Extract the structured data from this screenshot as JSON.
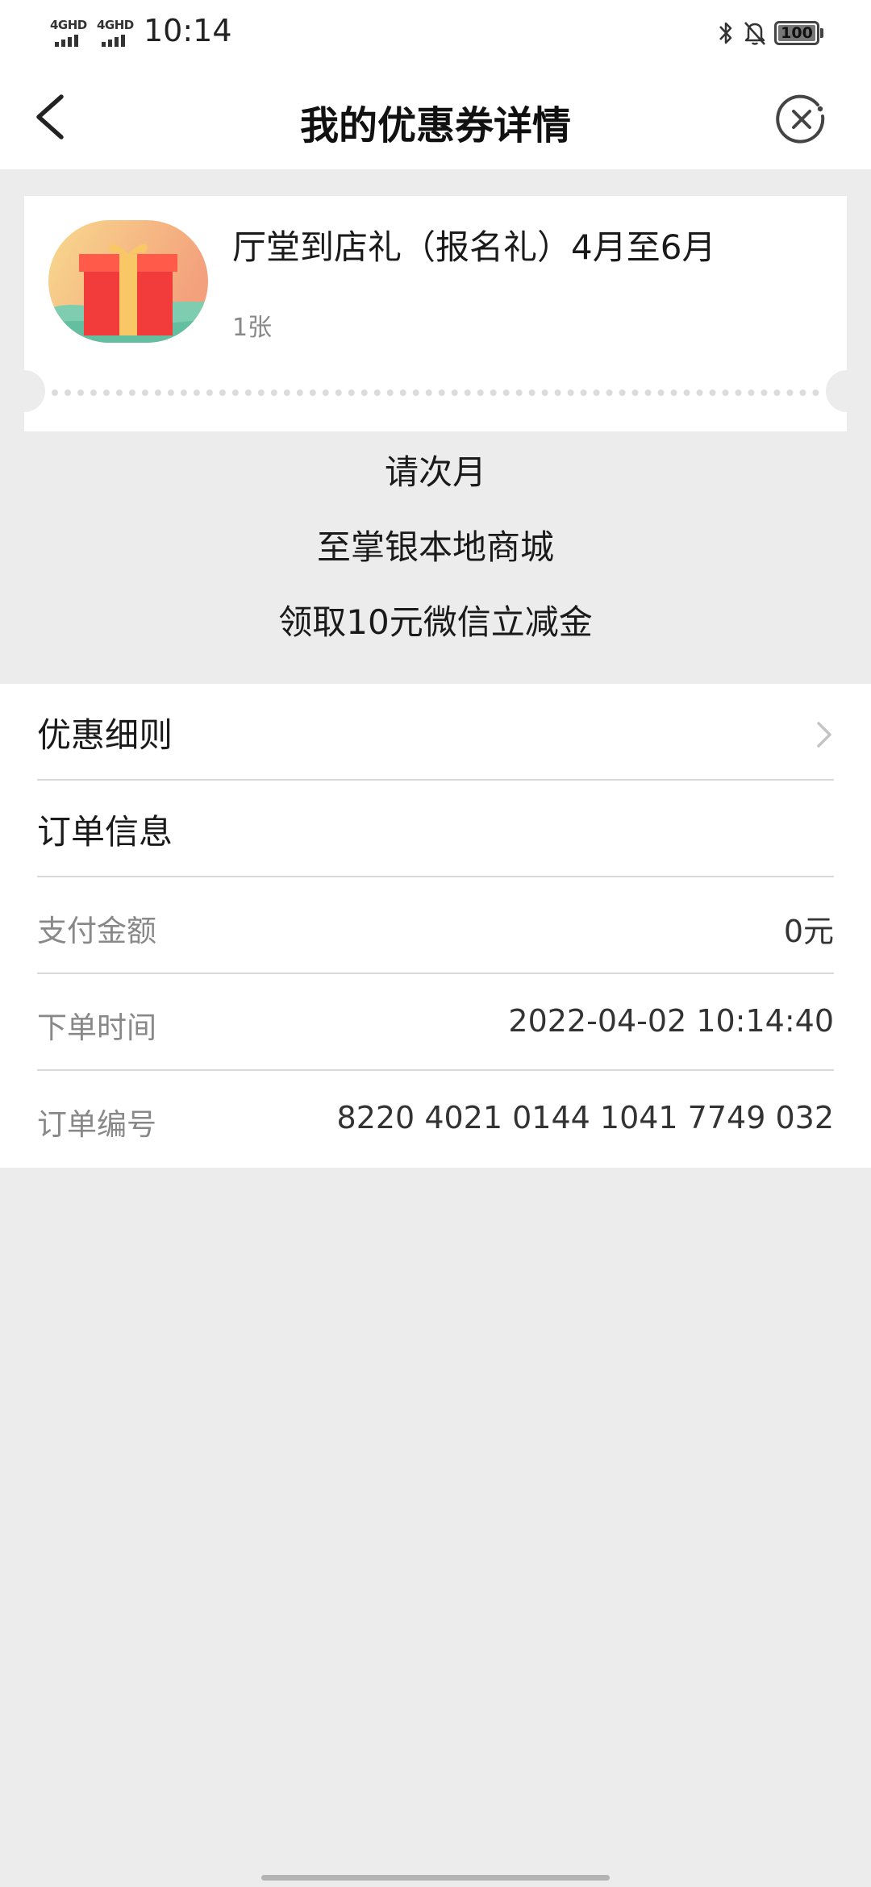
{
  "status_bar": {
    "network_1": "4GHD",
    "network_2": "4GHD",
    "time": "10:14",
    "battery": "100"
  },
  "header": {
    "title": "我的优惠券详情"
  },
  "coupon": {
    "title": "厅堂到店礼（报名礼）4月至6月",
    "quantity": "1张"
  },
  "instructions": [
    "请次月",
    "至掌银本地商城",
    "领取10元微信立减金"
  ],
  "details": {
    "terms_label": "优惠细则",
    "order_info_label": "订单信息",
    "rows": [
      {
        "label": "支付金额",
        "value": "0元"
      },
      {
        "label": "下单时间",
        "value": "2022-04-02 10:14:40"
      },
      {
        "label": "订单编号",
        "value": "8220 4021 0144 1041 7749 032"
      }
    ]
  }
}
